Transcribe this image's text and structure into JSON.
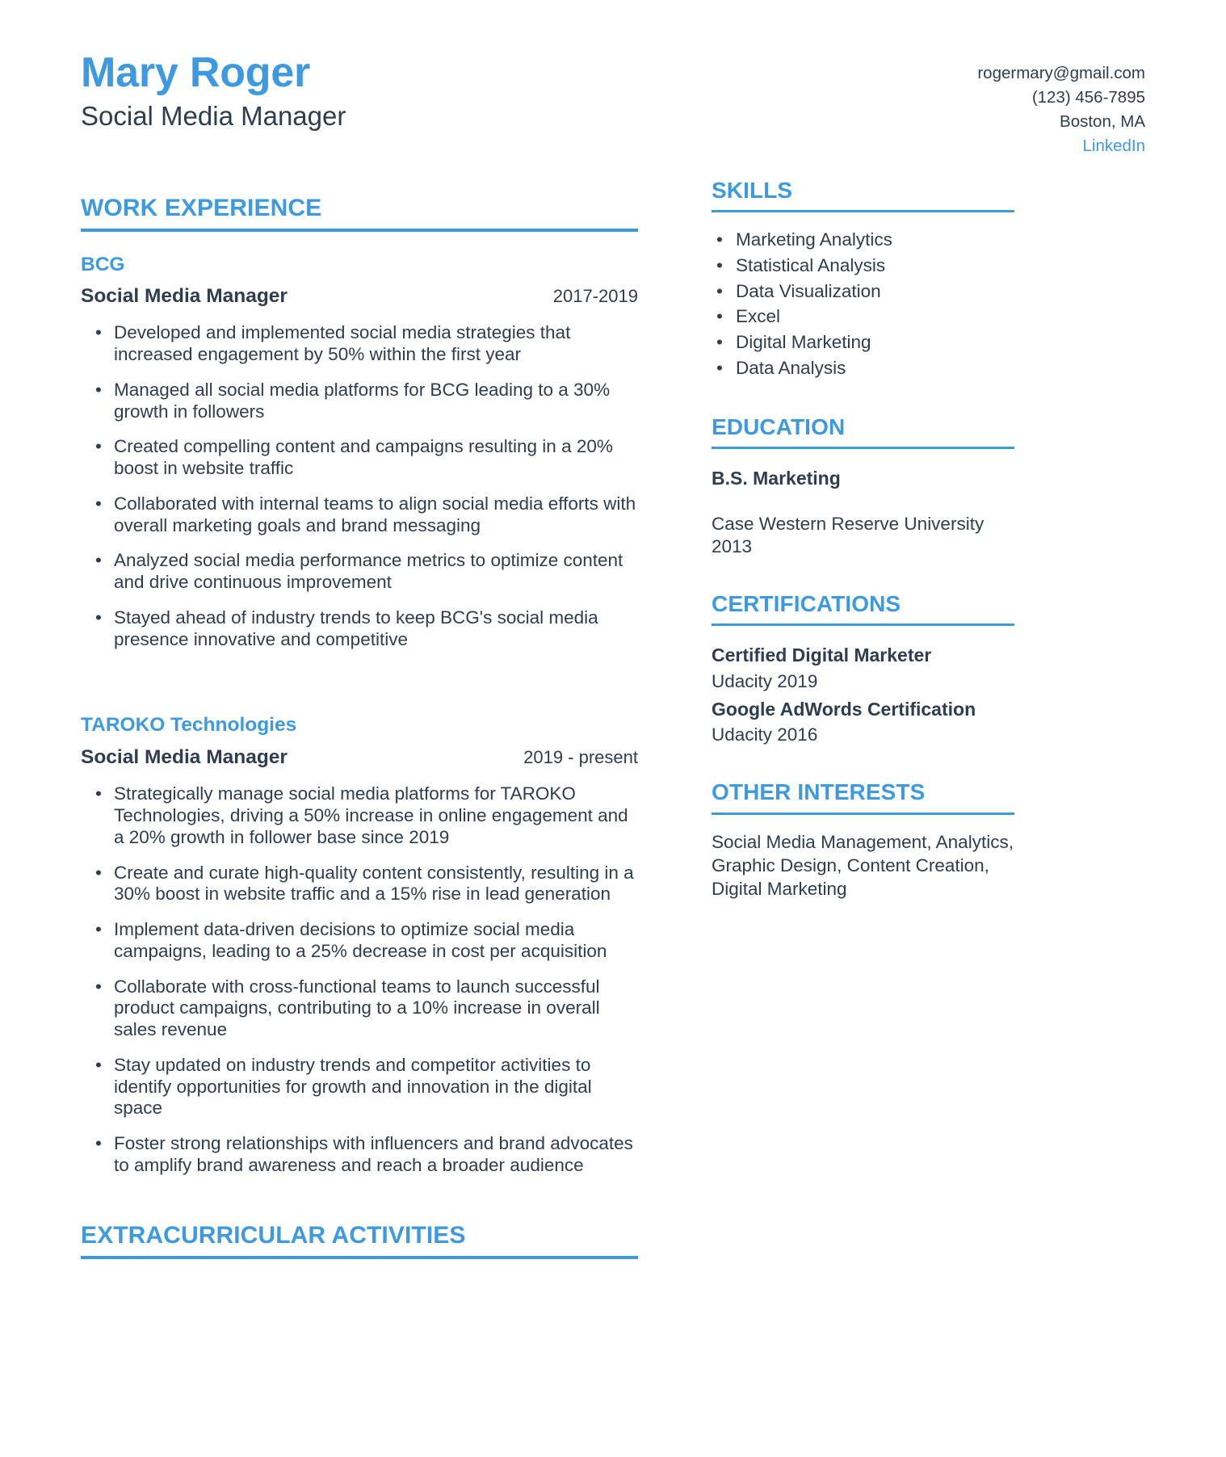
{
  "header": {
    "name": "Mary Roger",
    "headline": "Social Media Manager",
    "contact": {
      "email": "rogermary@gmail.com",
      "phone": "(123) 456-7895",
      "location": "Boston, MA",
      "link_label": "LinkedIn"
    }
  },
  "colors": {
    "accent": "#3d9ae0",
    "text": "#2e3d50",
    "background": "#ffffff"
  },
  "sections": {
    "work_experience_title": "WORK EXPERIENCE",
    "extracurricular_title": "EXTRACURRICULAR ACTIVITIES",
    "skills_title": "SKILLS",
    "education_title": "EDUCATION",
    "certifications_title": "CERTIFICATIONS",
    "other_interests_title": "OTHER INTERESTS"
  },
  "jobs": [
    {
      "company": "BCG",
      "title": "Social Media Manager",
      "dates": "2017-2019",
      "bullets": [
        "Developed and implemented social media strategies that increased engagement by 50% within the first year",
        "Managed all social media platforms for BCG leading to a 30% growth in followers",
        "Created compelling content and campaigns resulting in a 20% boost in website traffic",
        "Collaborated with internal teams to align social media efforts with overall marketing goals and brand messaging",
        "Analyzed social media performance metrics to optimize content and drive continuous improvement",
        "Stayed ahead of industry trends to keep BCG's social media presence innovative and competitive"
      ]
    },
    {
      "company": "TAROKO Technologies",
      "title": "Social Media Manager",
      "dates": "2019 - present",
      "bullets": [
        "Strategically manage social media platforms for TAROKO Technologies, driving a 50% increase in online engagement and a 20% growth in follower base since 2019",
        "Create and curate high-quality content consistently, resulting in a 30% boost in website traffic and a 15% rise in lead generation",
        "Implement data-driven decisions to optimize social media campaigns, leading to a 25% decrease in cost per acquisition",
        "Collaborate with cross-functional teams to launch successful product campaigns, contributing to a 10% increase in overall sales revenue",
        "Stay updated on industry trends and competitor activities to identify opportunities for growth and innovation in the digital space",
        "Foster strong relationships with influencers and brand advocates to amplify brand awareness and reach a broader audience"
      ]
    }
  ],
  "skills": [
    "Marketing Analytics",
    "Statistical Analysis",
    "Data Visualization",
    "Excel",
    "Digital Marketing",
    "Data Analysis"
  ],
  "education": {
    "degree": "B.S. Marketing",
    "school": "Case Western Reserve University",
    "year": "2013"
  },
  "certifications": [
    {
      "name": "Certified Digital Marketer",
      "provider": "Udacity 2019"
    },
    {
      "name": "Google AdWords Certification",
      "provider": "Udacity 2016"
    }
  ],
  "other_interests": "Social Media Management, Analytics, Graphic Design, Content Creation, Digital Marketing"
}
